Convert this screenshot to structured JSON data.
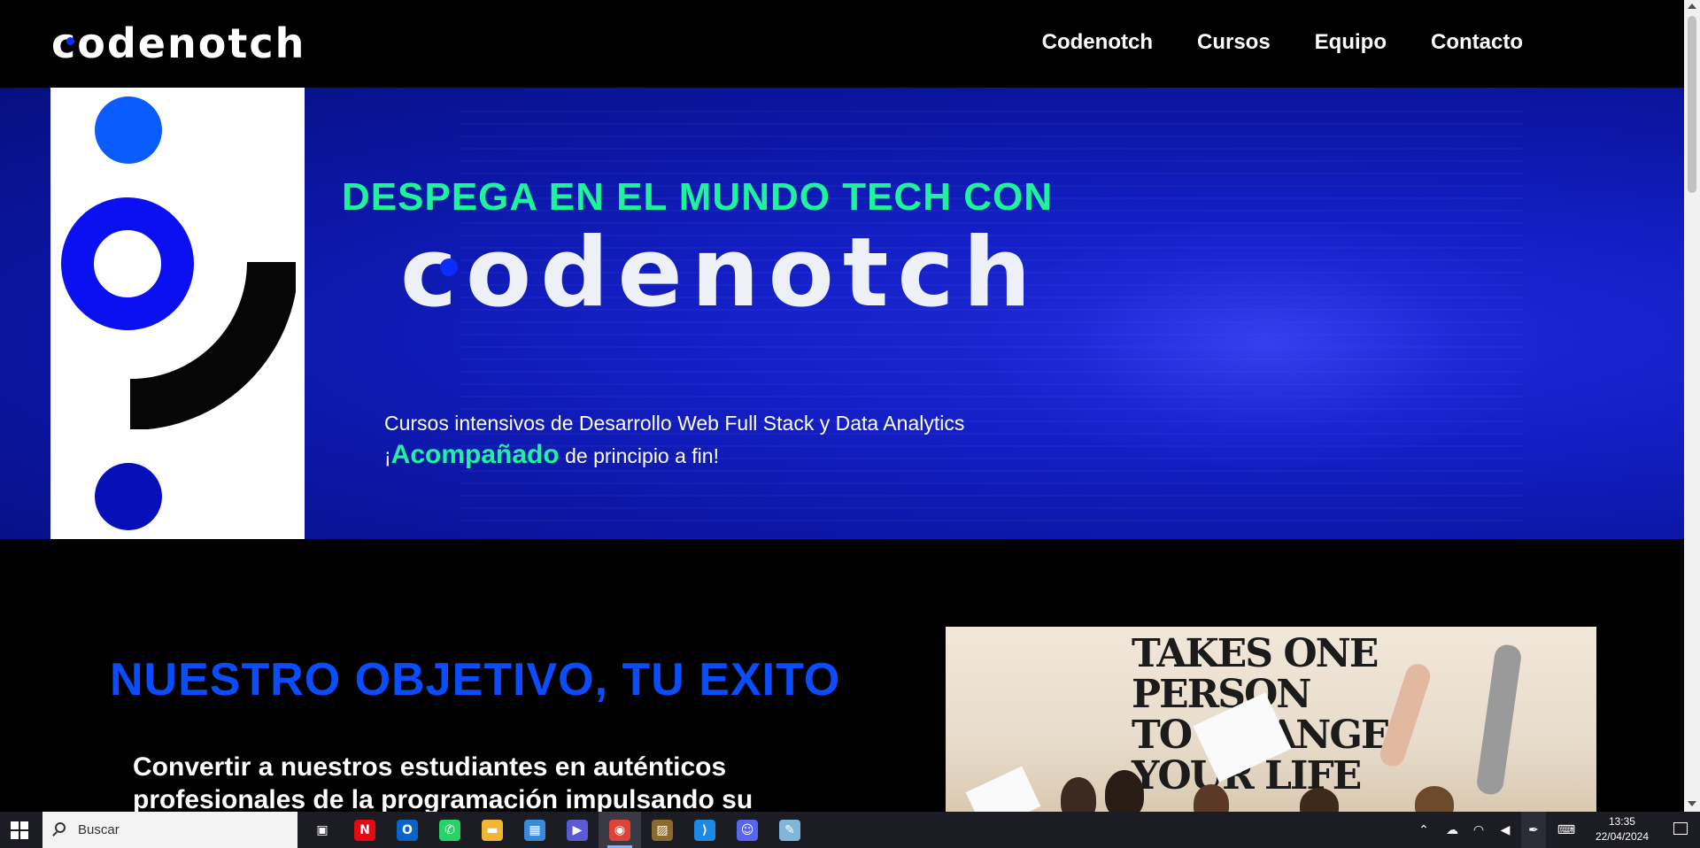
{
  "nav": {
    "logo_text": "codenotch",
    "links": [
      "Codenotch",
      "Cursos",
      "Equipo",
      "Contacto"
    ]
  },
  "hero": {
    "tagline": "DESPEGA EN EL MUNDO TECH CON",
    "brand": "codenotch",
    "subtitle": "Cursos intensivos de Desarrollo Web Full Stack y Data Analytics",
    "line2_prefix": "¡",
    "line2_accent": "Acompañado",
    "line2_suffix": " de principio a fin!"
  },
  "objective": {
    "title": "NUESTRO OBJETIVO, TU EXITO",
    "text": "Convertir a nuestros estudiantes en auténticos profesionales de la programación impulsando su"
  },
  "photo": {
    "wall_lines": [
      "TAKES ONE",
      "PERSON",
      "TO CHANGE",
      "YOUR LIFE"
    ]
  },
  "taskbar": {
    "search_placeholder": "Buscar",
    "apps": [
      {
        "name": "task-view-icon",
        "glyph": "▣",
        "color": "#1c1c24"
      },
      {
        "name": "netflix-icon",
        "glyph": "N",
        "color": "#e50914"
      },
      {
        "name": "outlook-icon",
        "glyph": "O",
        "color": "#0a64c8"
      },
      {
        "name": "whatsapp-icon",
        "glyph": "✆",
        "color": "#25d366"
      },
      {
        "name": "file-explorer-icon",
        "glyph": "▬",
        "color": "#f2b632"
      },
      {
        "name": "microsoft-store-icon",
        "glyph": "▦",
        "color": "#3b8ad9"
      },
      {
        "name": "power-automate-icon",
        "glyph": "▶",
        "color": "#5a5ad6"
      },
      {
        "name": "chrome-icon",
        "glyph": "◉",
        "color": "#db4437"
      },
      {
        "name": "photos-icon",
        "glyph": "▨",
        "color": "#8c6a2e"
      },
      {
        "name": "vscode-icon",
        "glyph": "⟩",
        "color": "#1e88e5"
      },
      {
        "name": "discord-icon",
        "glyph": "☺",
        "color": "#5865f2"
      },
      {
        "name": "notepad-icon",
        "glyph": "✎",
        "color": "#7fb6d9"
      }
    ],
    "active_app": "chrome-icon",
    "time": "13:35",
    "date": "22/04/2024"
  }
}
